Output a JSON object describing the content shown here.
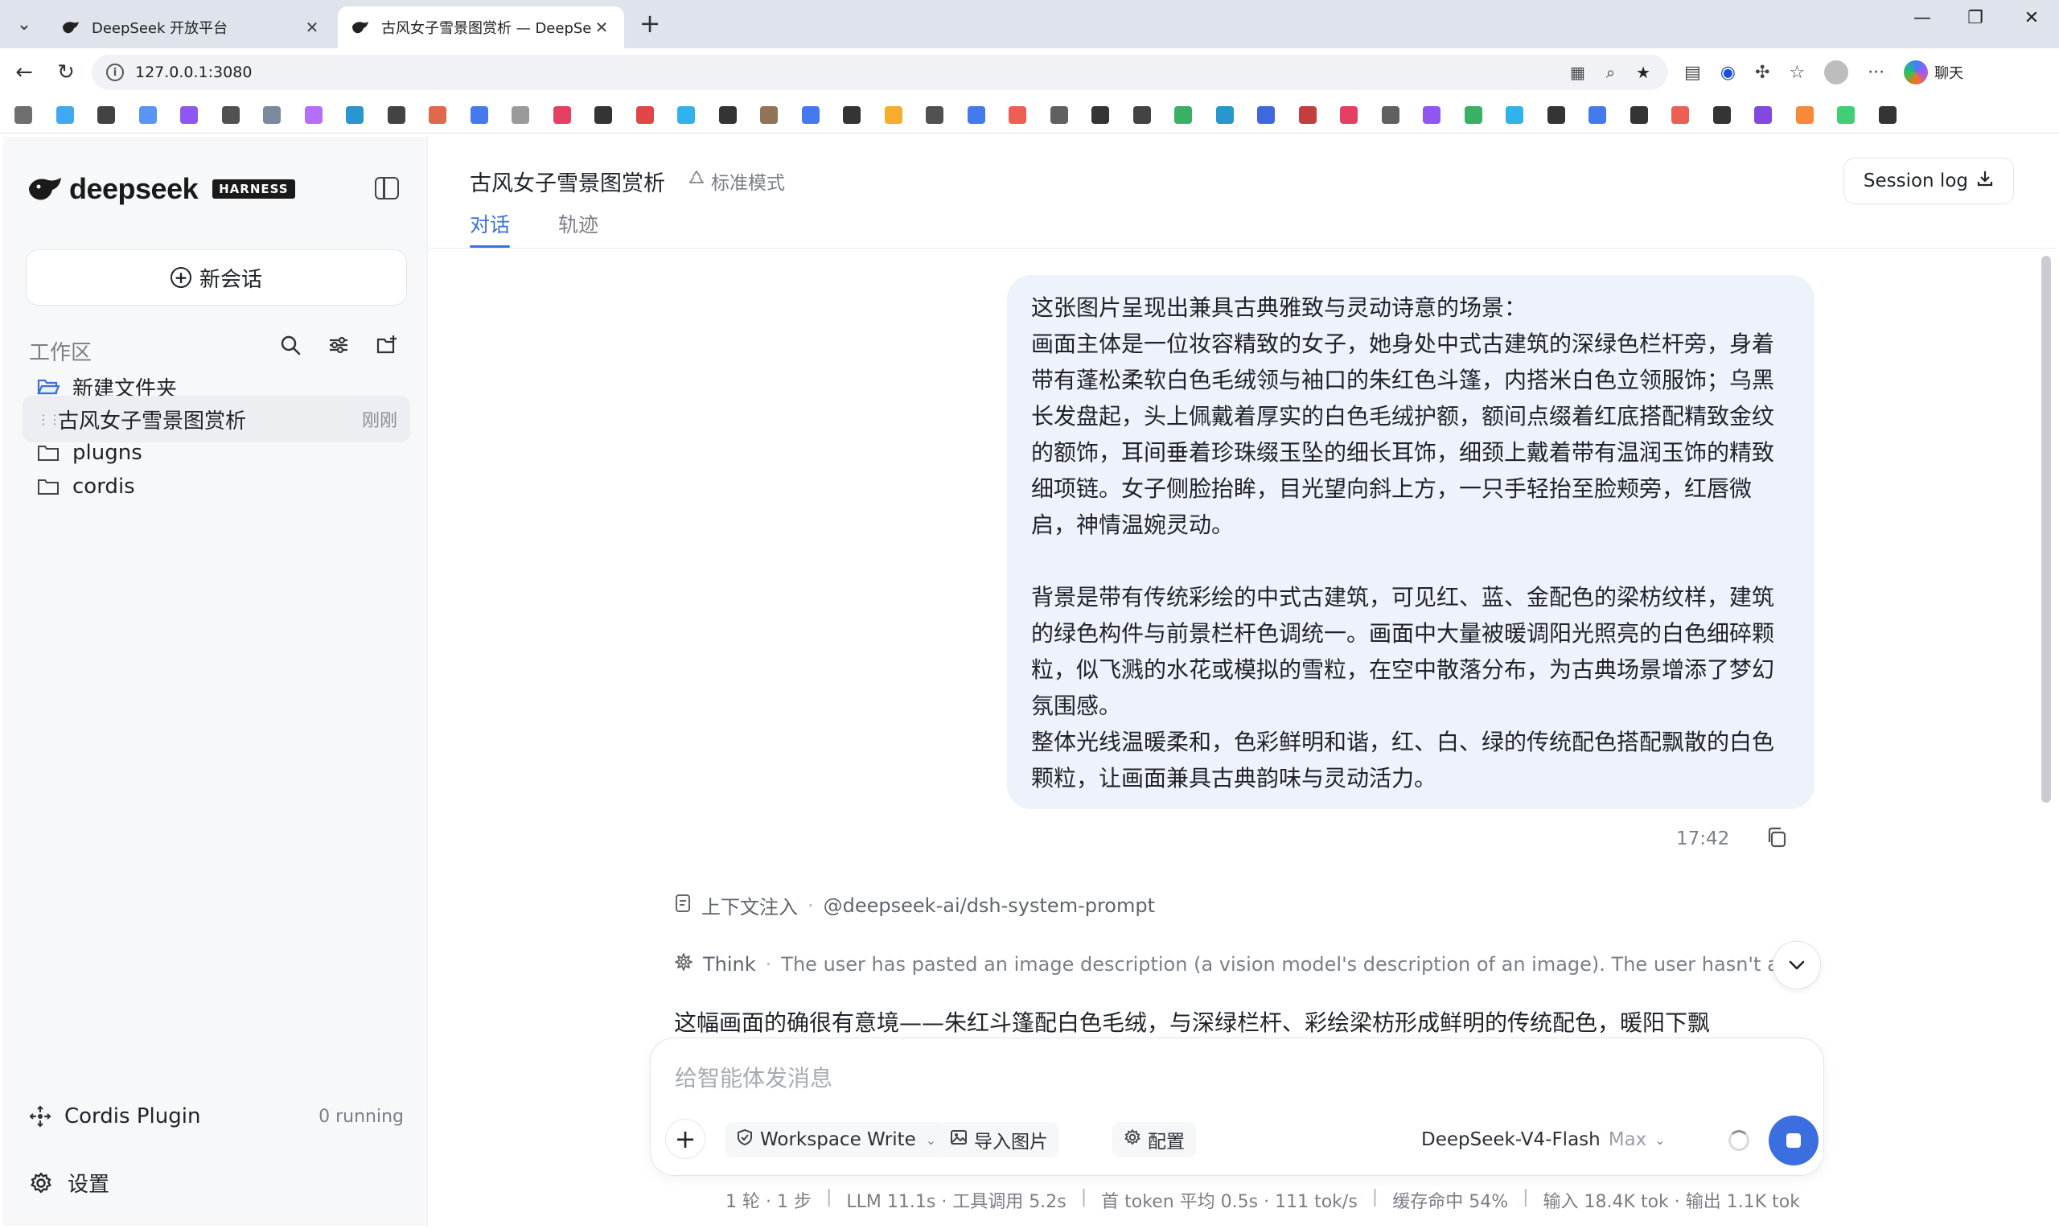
{
  "browser": {
    "tabs": [
      {
        "title": "DeepSeek 开放平台",
        "active": false
      },
      {
        "title": "古风女子雪景图赏析 — DeepSeek",
        "active": true
      }
    ],
    "url": "127.0.0.1:3080",
    "chat_label": "聊天"
  },
  "sidebar": {
    "brand": "deepseek",
    "badge": "HARNESS",
    "new_chat": "新会话",
    "workspace_label": "工作区",
    "tree": [
      {
        "label": "新建文件夹",
        "type": "folder-open",
        "time": ""
      },
      {
        "label": "古风女子雪景图赏析",
        "type": "session",
        "time": "刚刚",
        "active": true
      },
      {
        "label": "plugns",
        "type": "folder",
        "time": ""
      },
      {
        "label": "cordis",
        "type": "folder",
        "time": ""
      }
    ],
    "plugin": {
      "label": "Cordis Plugin",
      "count": "0 running"
    },
    "settings": "设置"
  },
  "header": {
    "title": "古风女子雪景图赏析",
    "mode": "标准模式",
    "tabs": [
      "对话",
      "轨迹"
    ],
    "session_log": "Session log"
  },
  "message": {
    "paragraphs": [
      "这张图片呈现出兼具古典雅致与灵动诗意的场景：",
      "画面主体是一位妆容精致的女子，她身处中式古建筑的深绿色栏杆旁，身着带有蓬松柔软白色毛绒领与袖口的朱红色斗篷，内搭米白色立领服饰；乌黑长发盘起，头上佩戴着厚实的白色毛绒护额，额间点缀着红底搭配精致金纹的额饰，耳间垂着珍珠缀玉坠的细长耳饰，细颈上戴着带有温润玉饰的精致细项链。女子侧脸抬眸，目光望向斜上方，一只手轻抬至脸颊旁，红唇微启，神情温婉灵动。",
      "",
      "背景是带有传统彩绘的中式古建筑，可见红、蓝、金配色的梁枋纹样，建筑的绿色构件与前景栏杆色调统一。画面中大量被暖调阳光照亮的白色细碎颗粒，似飞溅的水花或模拟的雪粒，在空中散落分布，为古典场景增添了梦幻氛围感。",
      "整体光线温暖柔和，色彩鲜明和谐，红、白、绿的传统配色搭配飘散的白色颗粒，让画面兼具古典韵味与灵动活力。"
    ],
    "time": "17:42"
  },
  "context": {
    "label": "上下文注入",
    "value": "@deepseek-ai/dsh-system-prompt"
  },
  "think": {
    "label": "Think",
    "text": "The user has pasted an image description (a vision model's description of an image). The user hasn't actually"
  },
  "reply_preview": "这幅画面的确很有意境——朱红斗篷配白色毛绒，与深绿栏杆、彩绘梁枋形成鲜明的传统配色，暖阳下飘",
  "composer": {
    "placeholder": "给智能体发消息",
    "workspace_mode": "Workspace Write",
    "import_image": "导入图片",
    "config": "配置",
    "model": "DeepSeek-V4-Flash",
    "level": "Max"
  },
  "stats": [
    "1 轮 · 1 步",
    "LLM 11.1s · 工具调用 5.2s",
    "首 token 平均 0.5s · 111 tok/s",
    "缓存命中 54%",
    "输入 18.4K tok · 输出 1.1K tok"
  ],
  "colors": {
    "accent": "#3b6fe0",
    "bubble": "#eef2fb"
  }
}
